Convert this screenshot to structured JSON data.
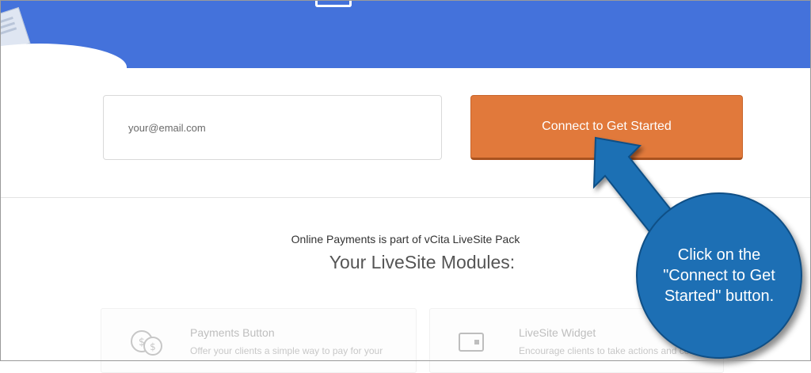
{
  "signup": {
    "email_placeholder": "your@email.com",
    "connect_label": "Connect to Get Started"
  },
  "livesite": {
    "pack_text": "Online Payments is part of vCita LiveSite Pack",
    "modules_title": "Your LiveSite Modules:"
  },
  "modules": [
    {
      "title": "Payments Button",
      "description": "Offer your clients a simple way to pay for your",
      "icon": "coins-icon"
    },
    {
      "title": "LiveSite Widget",
      "description": "Encourage clients to take actions and connect",
      "icon": "widget-icon"
    }
  ],
  "annotation": {
    "callout_text": "Click on the \"Connect to Get Started\" button.",
    "colors": {
      "callout_fill": "#1d6fb4",
      "arrow": "#1d6fb4"
    }
  },
  "colors": {
    "hero": "#4472db",
    "connect_button": "#e1793b"
  }
}
